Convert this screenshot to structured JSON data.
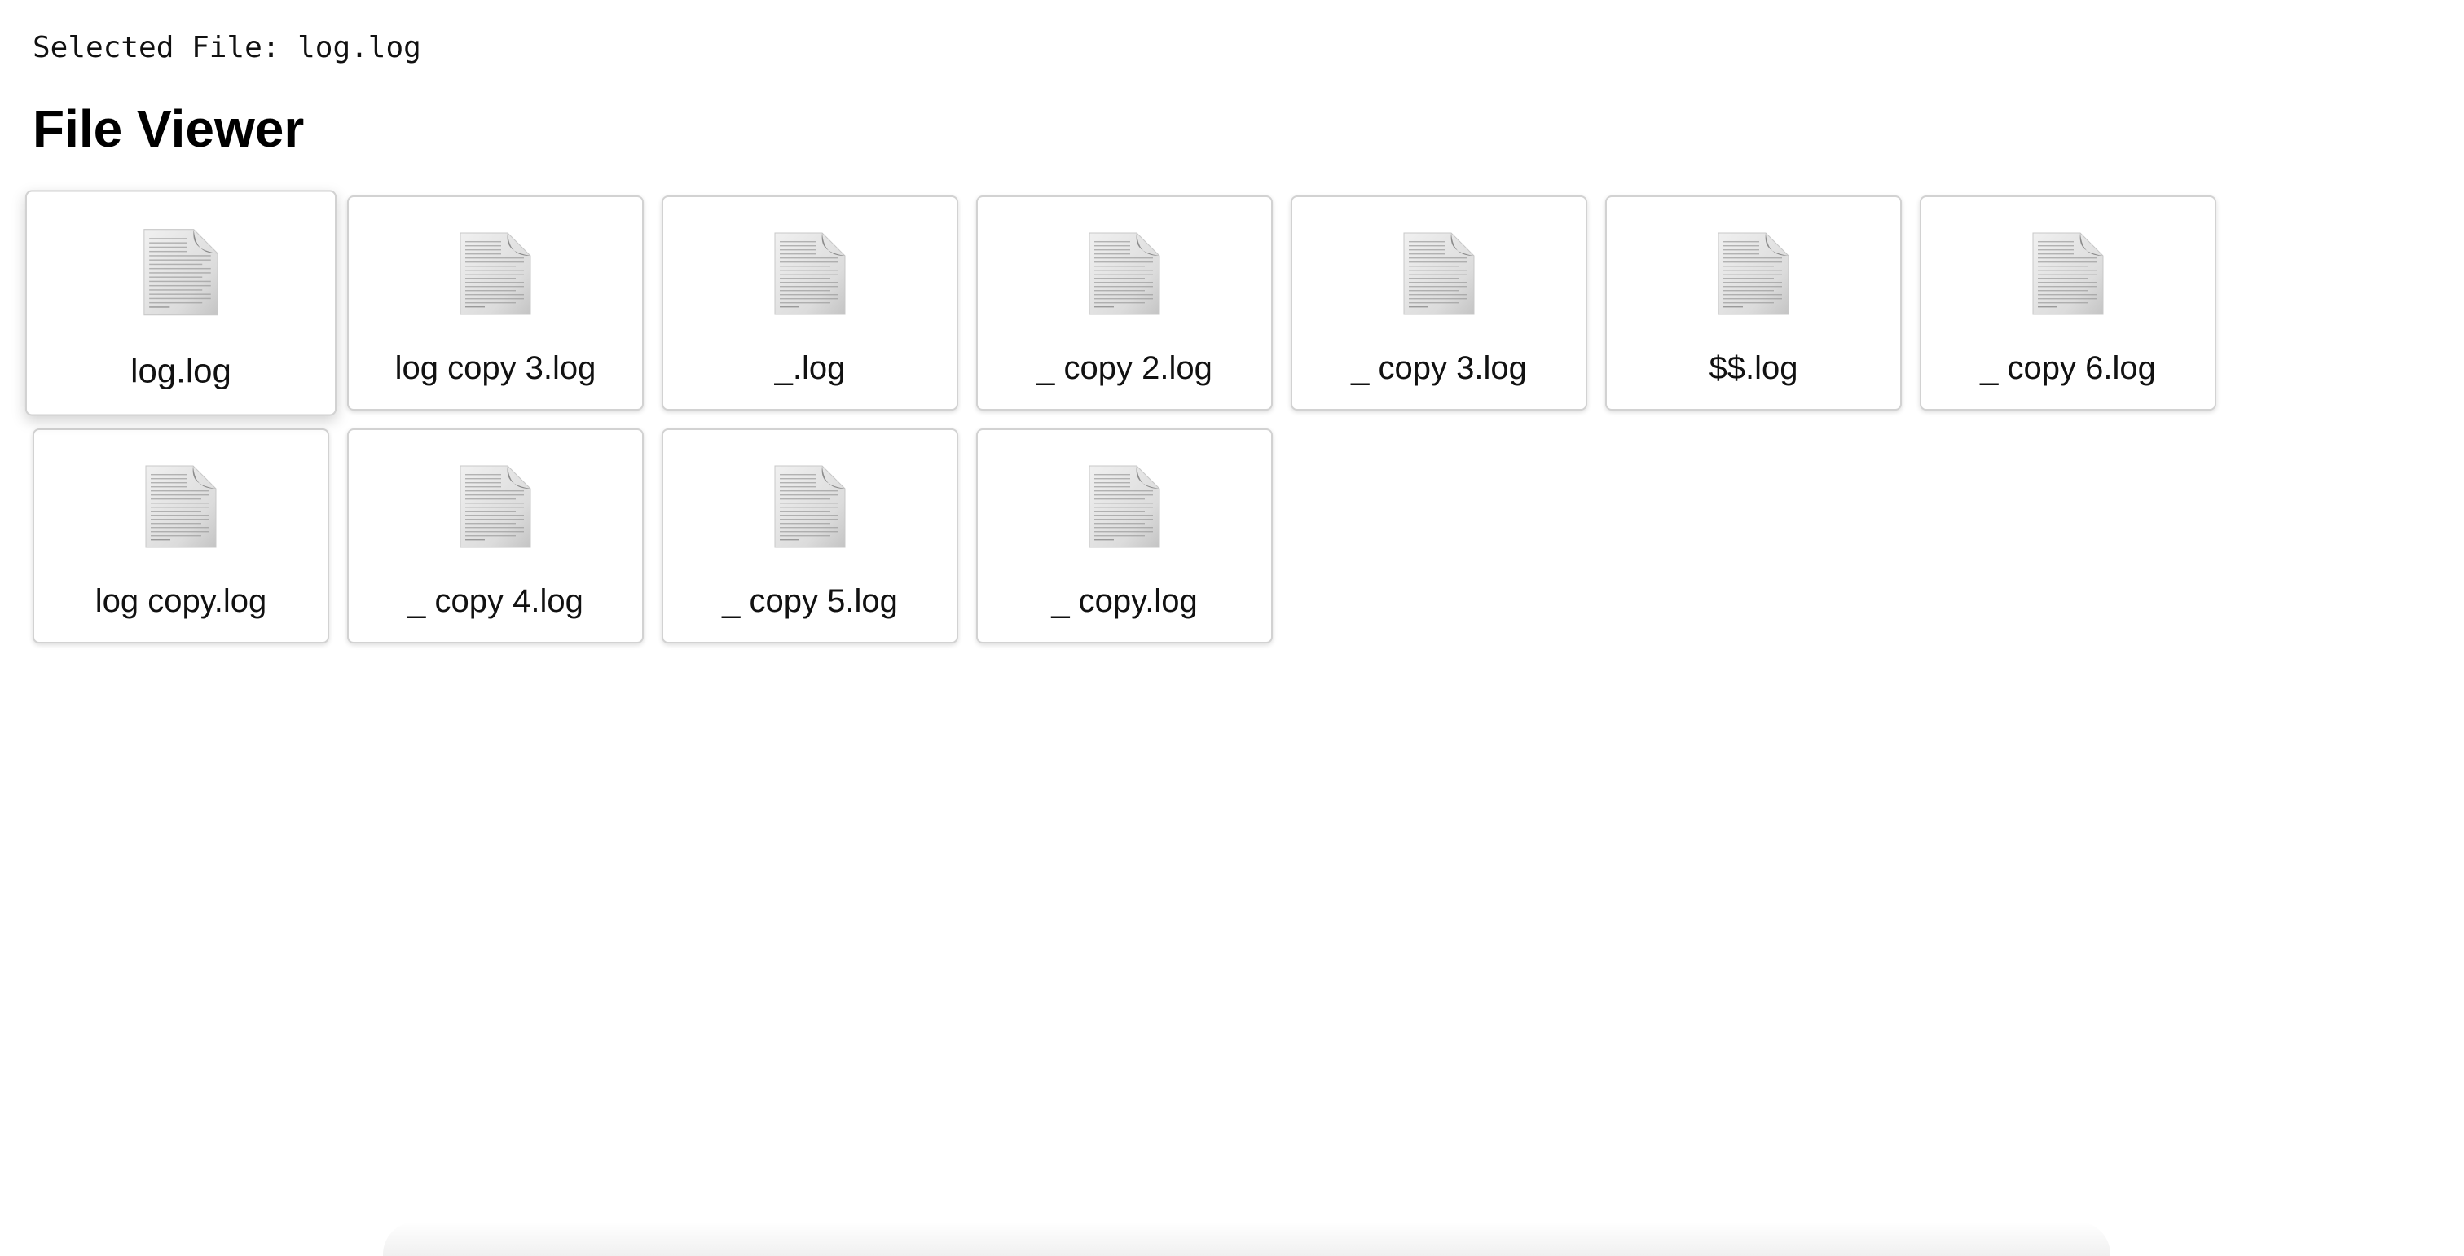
{
  "header": {
    "selected_label": "Selected File: log.log",
    "title": "File Viewer"
  },
  "files": [
    {
      "name": "log.log",
      "icon": "document-icon",
      "selected": true
    },
    {
      "name": "log copy 3.log",
      "icon": "document-icon",
      "selected": false
    },
    {
      "name": "_.log",
      "icon": "document-icon",
      "selected": false
    },
    {
      "name": "_ copy 2.log",
      "icon": "document-icon",
      "selected": false
    },
    {
      "name": "_ copy 3.log",
      "icon": "document-icon",
      "selected": false
    },
    {
      "name": "$$.log",
      "icon": "document-icon",
      "selected": false
    },
    {
      "name": "_ copy 6.log",
      "icon": "document-icon",
      "selected": false
    },
    {
      "name": "log copy.log",
      "icon": "document-icon",
      "selected": false
    },
    {
      "name": "_ copy 4.log",
      "icon": "document-icon",
      "selected": false
    },
    {
      "name": "_ copy 5.log",
      "icon": "document-icon",
      "selected": false
    },
    {
      "name": "_ copy.log",
      "icon": "document-icon",
      "selected": false
    }
  ],
  "colors": {
    "tile_border": "#d2d2d2",
    "text": "#111111",
    "background": "#ffffff"
  }
}
